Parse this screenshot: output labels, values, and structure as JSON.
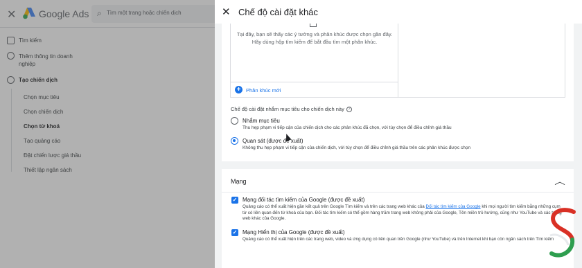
{
  "app": {
    "name": "Google Ads",
    "search_placeholder": "Tìm một trang hoặc chiến dịch"
  },
  "sidebar": {
    "main_items": [
      {
        "label": "Tìm kiếm",
        "icon": "search-page-icon"
      },
      {
        "label": "Thêm thông tin doanh nghiệp",
        "icon": "check-circle-icon"
      },
      {
        "label": "Tạo chiến dịch",
        "icon": "circle-icon"
      }
    ],
    "sub_items": [
      {
        "label": "Chọn mục tiêu"
      },
      {
        "label": "Chọn chiến dịch"
      },
      {
        "label": "Chọn từ khoá"
      },
      {
        "label": "Tạo quảng cáo"
      },
      {
        "label": "Đặt chiến lược giá thầu"
      },
      {
        "label": "Thiết lập ngân sách"
      }
    ],
    "active_sub": "Chọn từ khoá"
  },
  "panel": {
    "title": "Chế độ cài đặt khác",
    "segments": {
      "empty_line1": "Tại đây, bạn sẽ thấy các ý tưởng và phân khúc được chọn gần đây.",
      "empty_line2": "Hãy dùng hộp tìm kiếm để bắt đầu tìm một phân khúc.",
      "add_label": "Phân khúc mới"
    },
    "targeting": {
      "label": "Chế độ cài đặt nhắm mục tiêu cho chiến dịch này",
      "options": [
        {
          "title": "Nhắm mục tiêu",
          "desc": "Thu hẹp phạm vi tiếp cận của chiến dịch cho các phân khúc đã chọn, với tùy chọn để điều chỉnh giá thầu",
          "selected": false
        },
        {
          "title": "Quan sát (được đề xuất)",
          "desc": "Không thu hẹp phạm vi tiếp cận của chiến dịch, với tùy chọn để điều chỉnh giá thầu trên các phân khúc được chọn",
          "selected": true
        }
      ]
    },
    "network": {
      "title": "Mạng",
      "items": [
        {
          "title": "Mạng đối tác tìm kiếm của Google (được đề xuất)",
          "desc_before": "Quảng cáo có thể xuất hiện gần kết quả trên Google Tìm kiếm và trên các trang web khác của ",
          "link": "Đối tác tìm kiếm của Google",
          "desc_after": " khi mọi người tìm kiếm bằng những cụm từ có liên quan đến từ khoá của bạn. Đối tác tìm kiếm có thể gồm hàng trăm trang web không phải của Google, Tên miền trỏ hướng, cũng như YouTube và các trang web khác của Google.",
          "checked": true
        },
        {
          "title": "Mạng Hiển thị của Google (được đề xuất)",
          "desc_before": "Quảng cáo có thể xuất hiện trên các trang web, video và ứng dụng có liên quan trên Google (như YouTube) và trên Internet khi bạn còn ngân sách trên Tìm kiếm",
          "link": "",
          "desc_after": "",
          "checked": true
        }
      ]
    }
  },
  "colors": {
    "accent": "#1a73e8",
    "dim_overlay": "rgba(70,70,70,0.42)"
  }
}
